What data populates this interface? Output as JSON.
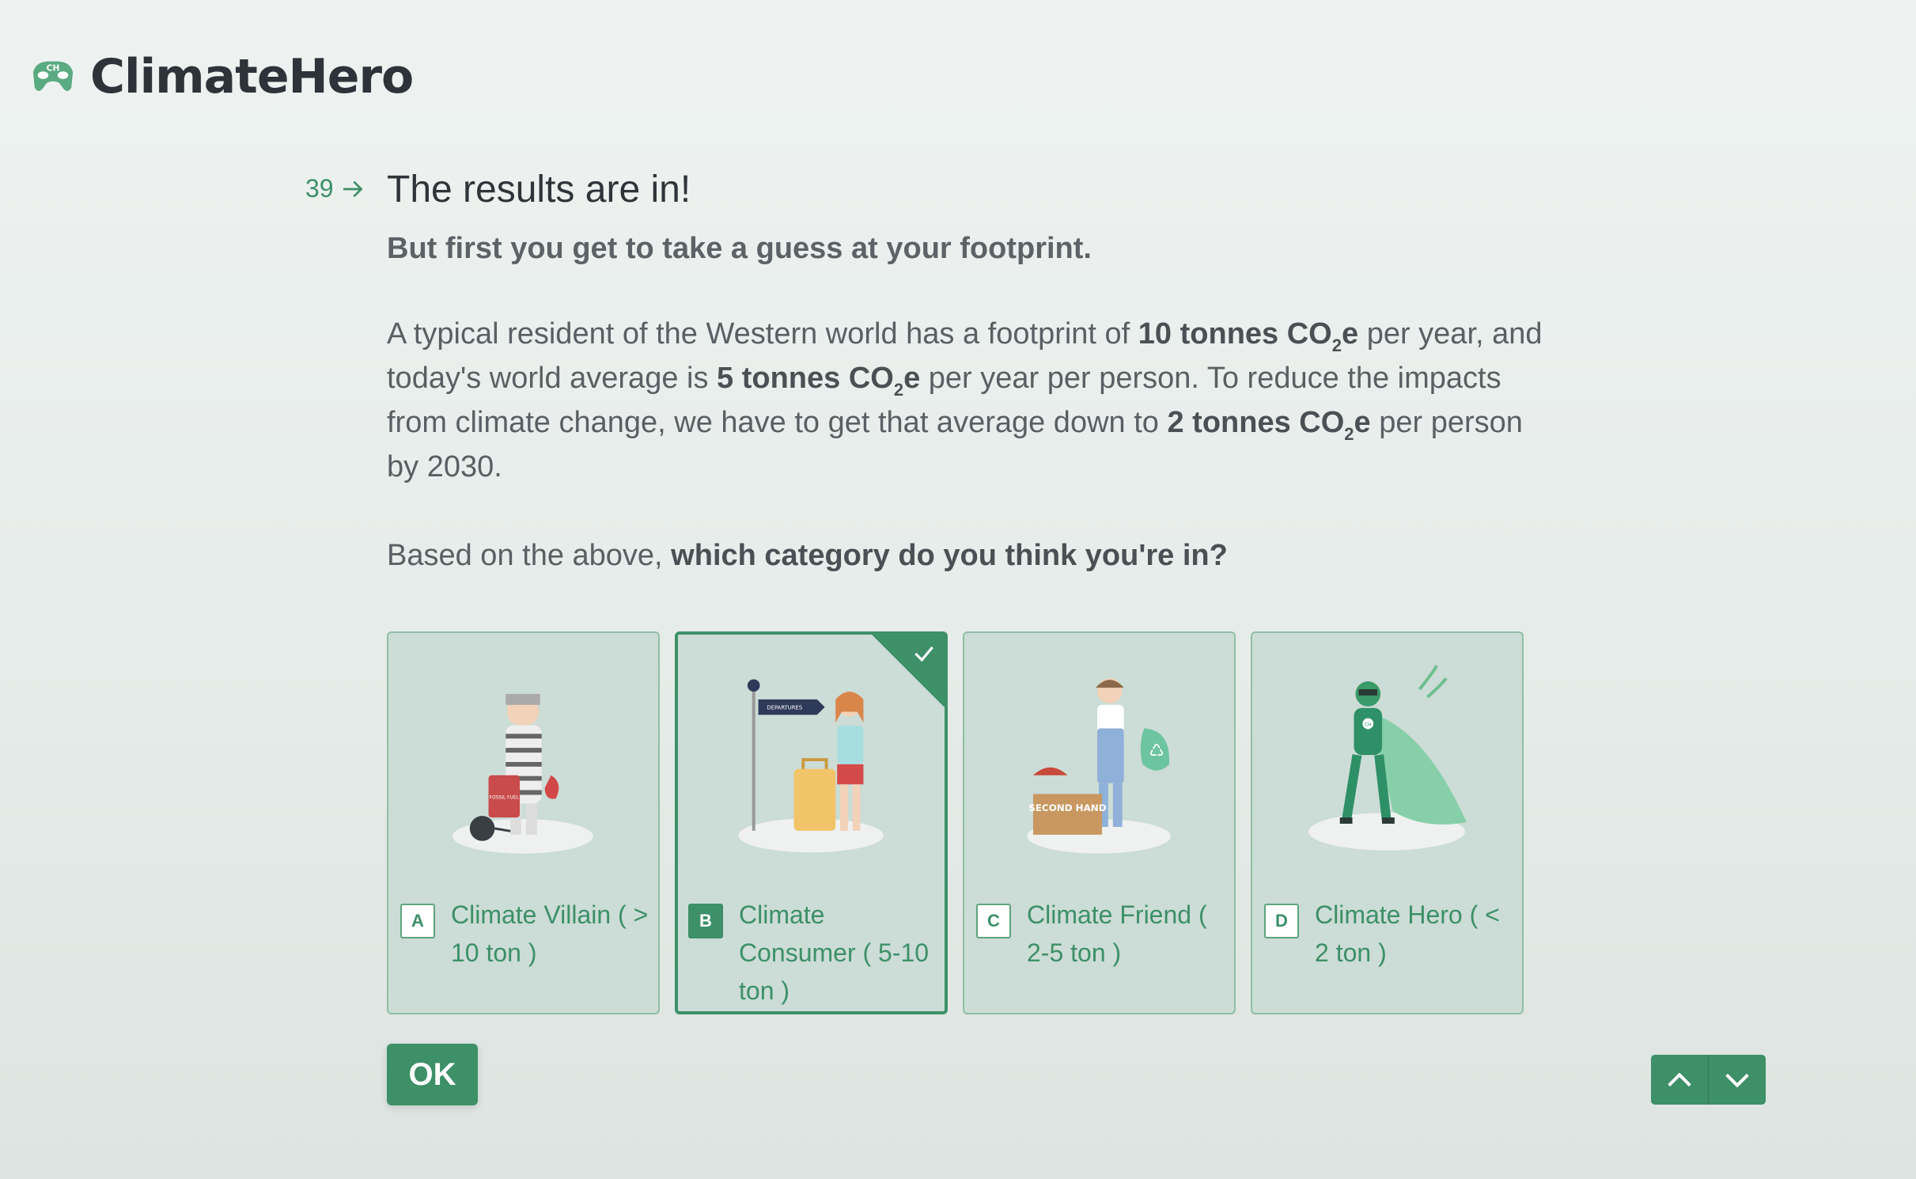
{
  "brand": {
    "name": "ClimateHero",
    "logo_text": "CH",
    "accent": "#3d9068"
  },
  "question": {
    "number": "39",
    "title": "The results are in!",
    "subtitle": "But first you get to take a guess at your footprint.",
    "paragraph": {
      "p1": "A typical resident of the Western world has a footprint of ",
      "b1": "10 tonnes CO",
      "p2": " per year, and today's world average is ",
      "b2": "5 tonnes CO",
      "p3": " per year per person. To reduce the impacts from climate change, we have to get that average down to ",
      "b3": "2 tonnes CO",
      "p4": " per person by 2030.",
      "sub": "2",
      "e": "e"
    },
    "prompt_prefix": "Based on the above, ",
    "prompt_bold": "which category do you think you're in?"
  },
  "choices": [
    {
      "key": "A",
      "label": "Climate Villain ( > 10 ton )",
      "image_text": "FOSSIL FUEL",
      "selected": false
    },
    {
      "key": "B",
      "label": "Climate Consumer ( 5-10 ton )",
      "image_text": "DEPARTURES",
      "selected": true
    },
    {
      "key": "C",
      "label": "Climate Friend ( 2-5 ton )",
      "image_text": "SECOND HAND",
      "selected": false
    },
    {
      "key": "D",
      "label": "Climate Hero ( < 2 ton )",
      "image_text": "CH",
      "selected": false
    }
  ],
  "buttons": {
    "ok": "OK"
  },
  "icons": {
    "arrow": "arrow-right-icon",
    "up": "chevron-up-icon",
    "down": "chevron-down-icon",
    "check": "check-icon"
  }
}
